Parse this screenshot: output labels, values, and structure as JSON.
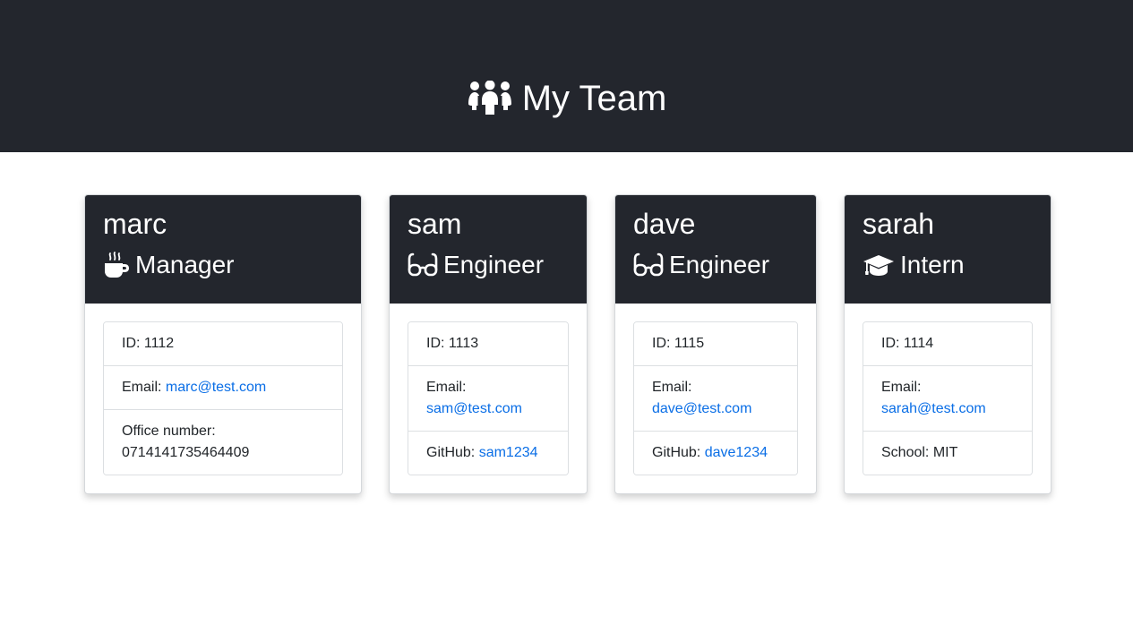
{
  "header": {
    "title": "My Team",
    "icon": "users-icon"
  },
  "colors": {
    "header_bg": "#23262d",
    "link": "#0a6ee6",
    "border": "#dcdfe2"
  },
  "employees": [
    {
      "name": "marc",
      "role": "Manager",
      "role_icon": "coffee-icon",
      "id_label": "ID: 1112",
      "email_label": "Email:",
      "email": "marc@test.com",
      "extra_label": "Office number:",
      "extra_value": "0714141735464409"
    },
    {
      "name": "sam",
      "role": "Engineer",
      "role_icon": "glasses-icon",
      "id_label": "ID: 1113",
      "email_label": "Email:",
      "email": "sam@test.com",
      "extra_label": "GitHub:",
      "extra_value": "sam1234"
    },
    {
      "name": "dave",
      "role": "Engineer",
      "role_icon": "glasses-icon",
      "id_label": "ID: 1115",
      "email_label": "Email:",
      "email": "dave@test.com",
      "extra_label": "GitHub:",
      "extra_value": "dave1234"
    },
    {
      "name": "sarah",
      "role": "Intern",
      "role_icon": "graduation-cap-icon",
      "id_label": "ID: 1114",
      "email_label": "Email:",
      "email": "sarah@test.com",
      "extra_label": "School:",
      "extra_value": "MIT"
    }
  ]
}
